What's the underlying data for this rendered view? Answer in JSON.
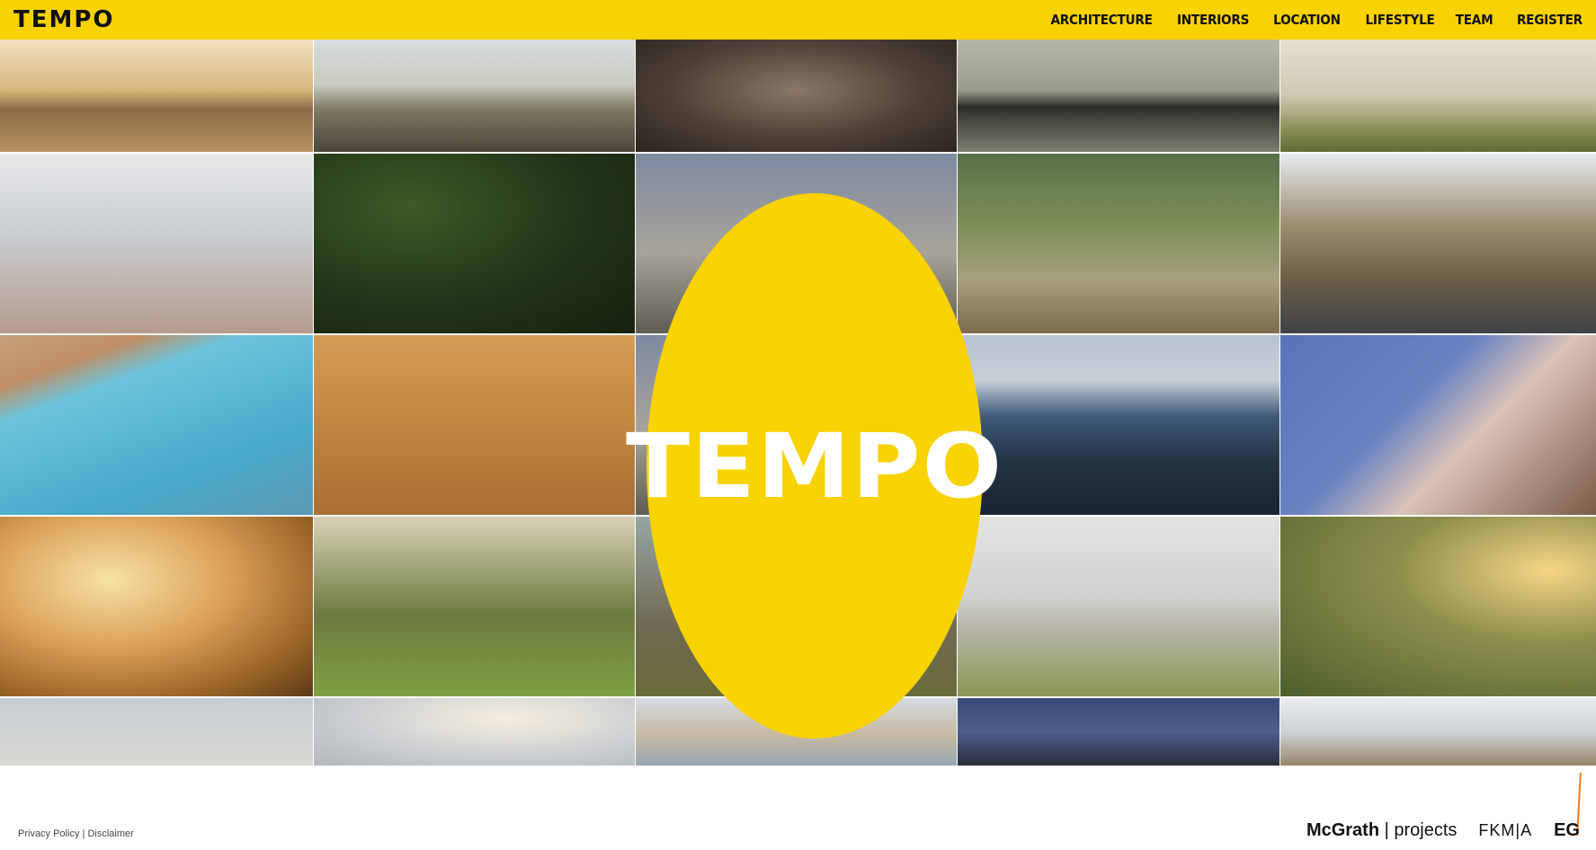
{
  "header": {
    "logo": "TEMPO",
    "nav": [
      "ARCHITECTURE",
      "INTERIORS",
      "LOCATION",
      "LIFESTYLE",
      "TEAM",
      "REGISTER"
    ]
  },
  "hero": {
    "wordmark": "TEMPO"
  },
  "footer": {
    "privacy": "Privacy Policy",
    "separator": " | ",
    "disclaimer": "Disclaimer",
    "partners": {
      "mcgrath": "McGrath",
      "mcgrath_sep": " | ",
      "projects": "projects",
      "fkma": "FKM|A",
      "eg": "EG"
    }
  },
  "colors": {
    "brand_yellow": "#f8d201",
    "accent_orange": "#ef7b1a"
  }
}
